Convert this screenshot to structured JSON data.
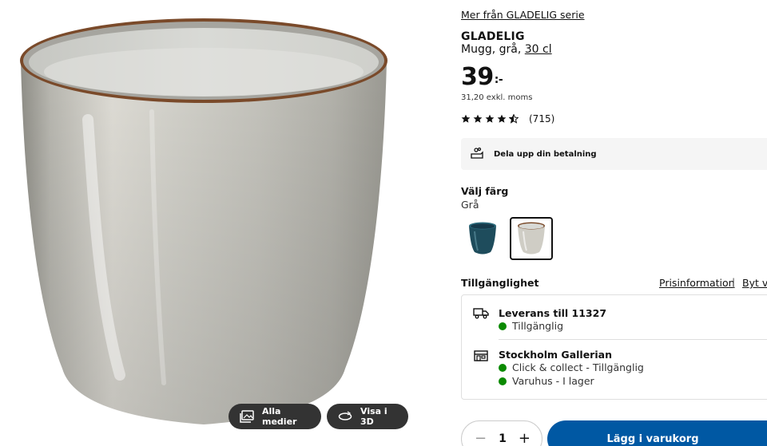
{
  "media": {
    "all_media_label": "Alla medier",
    "view_3d_label": "Visa i 3D"
  },
  "product": {
    "series_link": "Mer från GLADELIG serie",
    "brand": "GLADELIG",
    "description_prefix": "Mugg, grå,",
    "size": "30 cl",
    "price_main": "39",
    "price_suffix": ":-",
    "price_ex_vat": "31,20 exkl. moms",
    "rating_count": "(715)",
    "rating_stars": 4.5
  },
  "payment": {
    "label": "Dela upp din betalning"
  },
  "color": {
    "heading": "Välj färg",
    "selected": "Grå",
    "swatches": [
      {
        "name": "blue",
        "color": "#1f4f5f"
      },
      {
        "name": "grey",
        "color": "#c9c8c0"
      }
    ]
  },
  "availability": {
    "heading": "Tillgänglighet",
    "price_info_link": "Prisinformation",
    "separator": "|",
    "change_link": "Byt va",
    "delivery_title": "Leverans till 11327",
    "delivery_status": "Tillgänglig",
    "store_title": "Stockholm Gallerian",
    "store_status_1": "Click & collect - Tillgänglig",
    "store_status_2": "Varuhus - I lager",
    "status_color": "#0a8a00"
  },
  "cart": {
    "quantity": "1",
    "minus": "−",
    "plus": "+",
    "add_label": "Lägg i varukorg",
    "button_color": "#0058a3"
  }
}
